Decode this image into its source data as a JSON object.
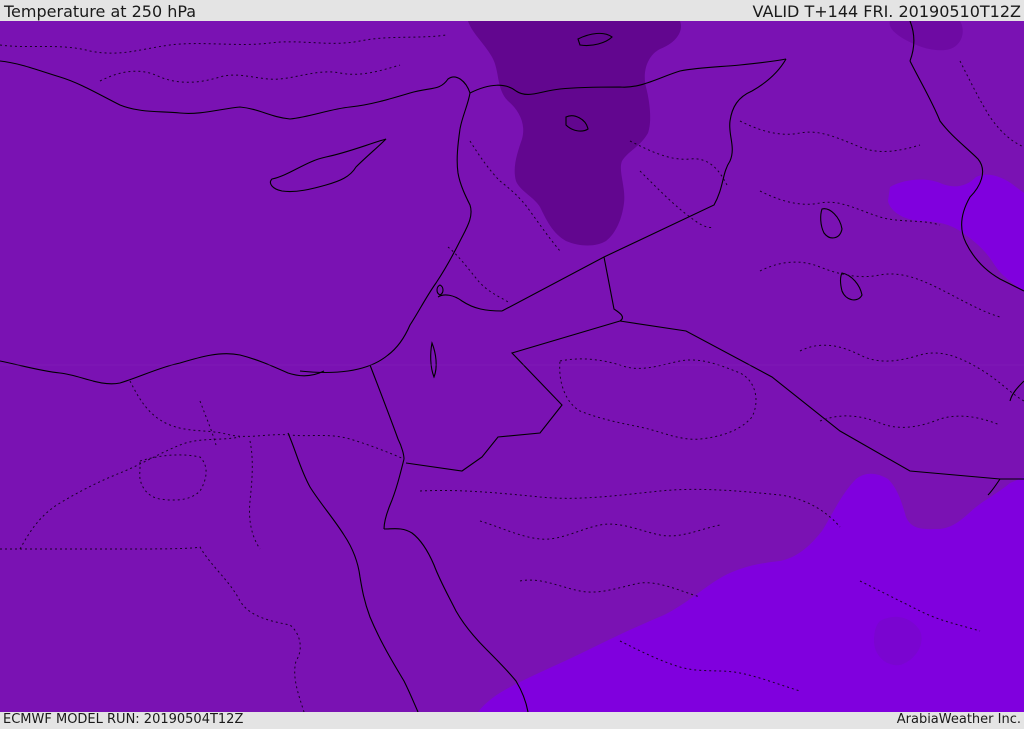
{
  "header": {
    "title": "Temperature at 250 hPa",
    "valid": "VALID T+144 FRI. 20190510T12Z"
  },
  "footer": {
    "model_run": "ECMWF MODEL RUN: 20190504T12Z",
    "credit": "ArabiaWeather Inc."
  },
  "map": {
    "colors": {
      "base_fill": "#7a12b3",
      "cold_pool": "#62068f",
      "cold_pool_edge": "#6e0aa3",
      "warm_fill": "#8000de",
      "warm_fill_edge": "#7a05d0",
      "border": "#000000"
    }
  }
}
